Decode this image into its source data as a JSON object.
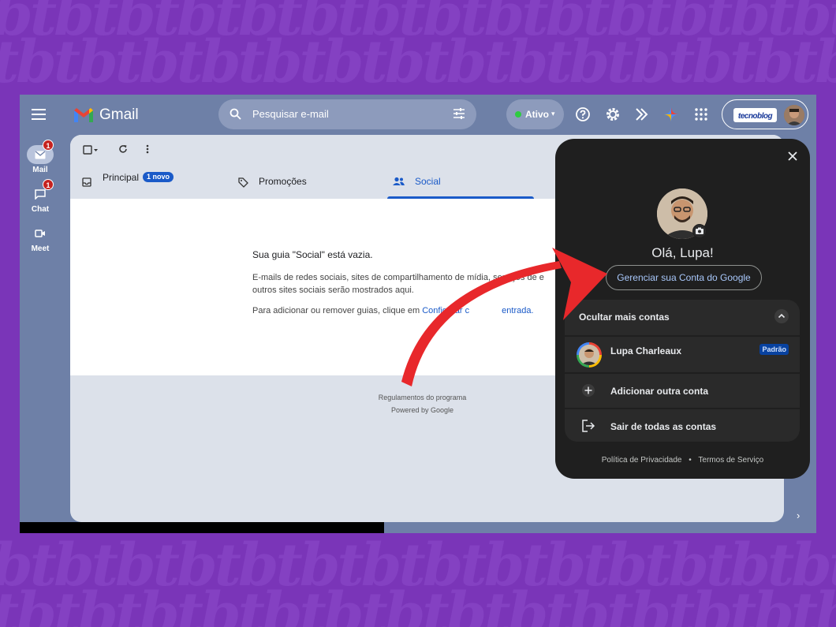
{
  "app": {
    "name": "Gmail"
  },
  "rail": {
    "items": [
      {
        "label": "Mail",
        "badge": "1"
      },
      {
        "label": "Chat",
        "badge": "1"
      },
      {
        "label": "Meet"
      }
    ]
  },
  "search": {
    "placeholder": "Pesquisar e-mail"
  },
  "status": {
    "label": "Ativo"
  },
  "account_brand": "tecnoblog",
  "tabs": [
    {
      "label": "Principal",
      "badge": "1 novo"
    },
    {
      "label": "Promoções"
    },
    {
      "label": "Social"
    }
  ],
  "empty_state": {
    "title": "Sua guia \"Social\" está vazia.",
    "desc_line1": "E-mails de redes sociais, sites de compartilhamento de mídia, serviços de e",
    "desc_line2": "outros sites sociais serão mostrados aqui.",
    "hint_prefix": "Para adicionar ou remover guias, clique em ",
    "hint_link": "Configurar c",
    "hint_link_end": "entrada."
  },
  "footer": {
    "program": "Regulamentos do programa",
    "powered": "Powered by Google"
  },
  "panel": {
    "greeting": "Olá, Lupa!",
    "manage_button": "Gerenciar sua Conta do Google",
    "hide_accounts": "Ocultar mais contas",
    "user_name": "Lupa Charleaux",
    "default_badge": "Padrão",
    "add_account": "Adicionar outra conta",
    "sign_out_all": "Sair de todas as contas",
    "privacy": "Política de Privacidade",
    "separator": "•",
    "terms": "Termos de Serviço"
  },
  "colors": {
    "background": "#7a35b8",
    "accent_blue": "#1a5ac8",
    "arrow_red": "#e8282b"
  }
}
